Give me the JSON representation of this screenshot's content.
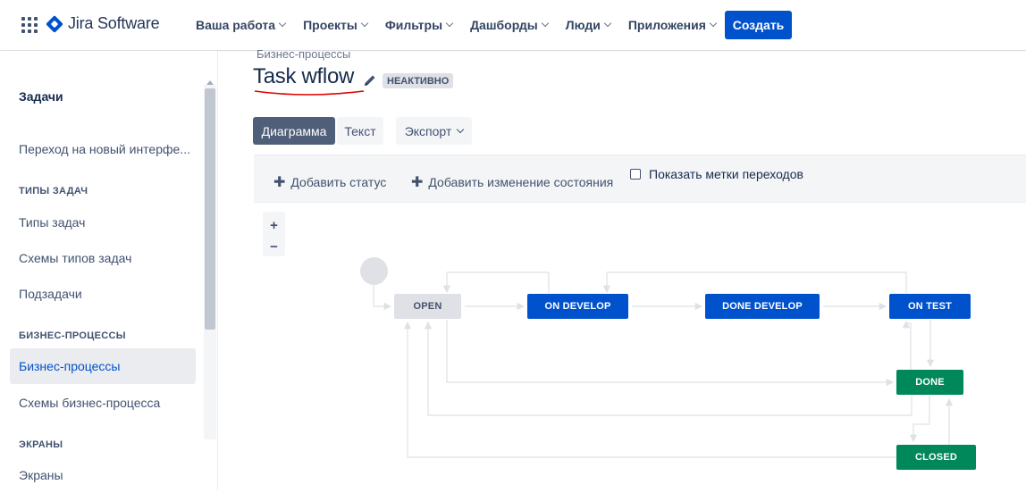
{
  "header": {
    "app_name": "Jira Software",
    "nav": [
      {
        "label": "Ваша работа"
      },
      {
        "label": "Проекты"
      },
      {
        "label": "Фильтры"
      },
      {
        "label": "Дашборды"
      },
      {
        "label": "Люди"
      },
      {
        "label": "Приложения"
      }
    ],
    "create_label": "Создать"
  },
  "sidebar": {
    "heading": "Задачи",
    "items": [
      {
        "label": "Переход на новый интерфе..."
      },
      {
        "label": "Типы задач"
      },
      {
        "label": "Схемы типов задач"
      },
      {
        "label": "Подзадачи"
      },
      {
        "label": "Бизнес-процессы"
      },
      {
        "label": "Схемы бизнес-процесса"
      },
      {
        "label": "Экраны"
      }
    ],
    "groups": [
      "ТИПЫ ЗАДАЧ",
      "БИЗНЕС-ПРОЦЕССЫ",
      "ЭКРАНЫ"
    ]
  },
  "main": {
    "breadcrumb": "Бизнес-процессы",
    "title": "Task wflow",
    "status": "НЕАКТИВНО",
    "views": {
      "diagram": "Диаграмма",
      "text": "Текст",
      "export": "Экспорт"
    },
    "toolbar": {
      "add_status": "Добавить статус",
      "add_transition": "Добавить изменение состояния",
      "show_labels": "Показать метки переходов",
      "show_labels_checked": false
    },
    "zoom": {
      "in": "+",
      "out": "−"
    },
    "workflow": {
      "statuses": [
        {
          "name": "OPEN",
          "category": "todo"
        },
        {
          "name": "ON DEVELOP",
          "category": "in-progress"
        },
        {
          "name": "DONE DEVELOP",
          "category": "in-progress"
        },
        {
          "name": "ON TEST",
          "category": "in-progress"
        },
        {
          "name": "DONE",
          "category": "done"
        },
        {
          "name": "CLOSED",
          "category": "done"
        }
      ]
    }
  },
  "colors": {
    "brand": "#0052cc",
    "in_progress": "#0052cc",
    "done": "#00875a",
    "todo": "#dfe1e6",
    "annotation": "#e00000"
  }
}
